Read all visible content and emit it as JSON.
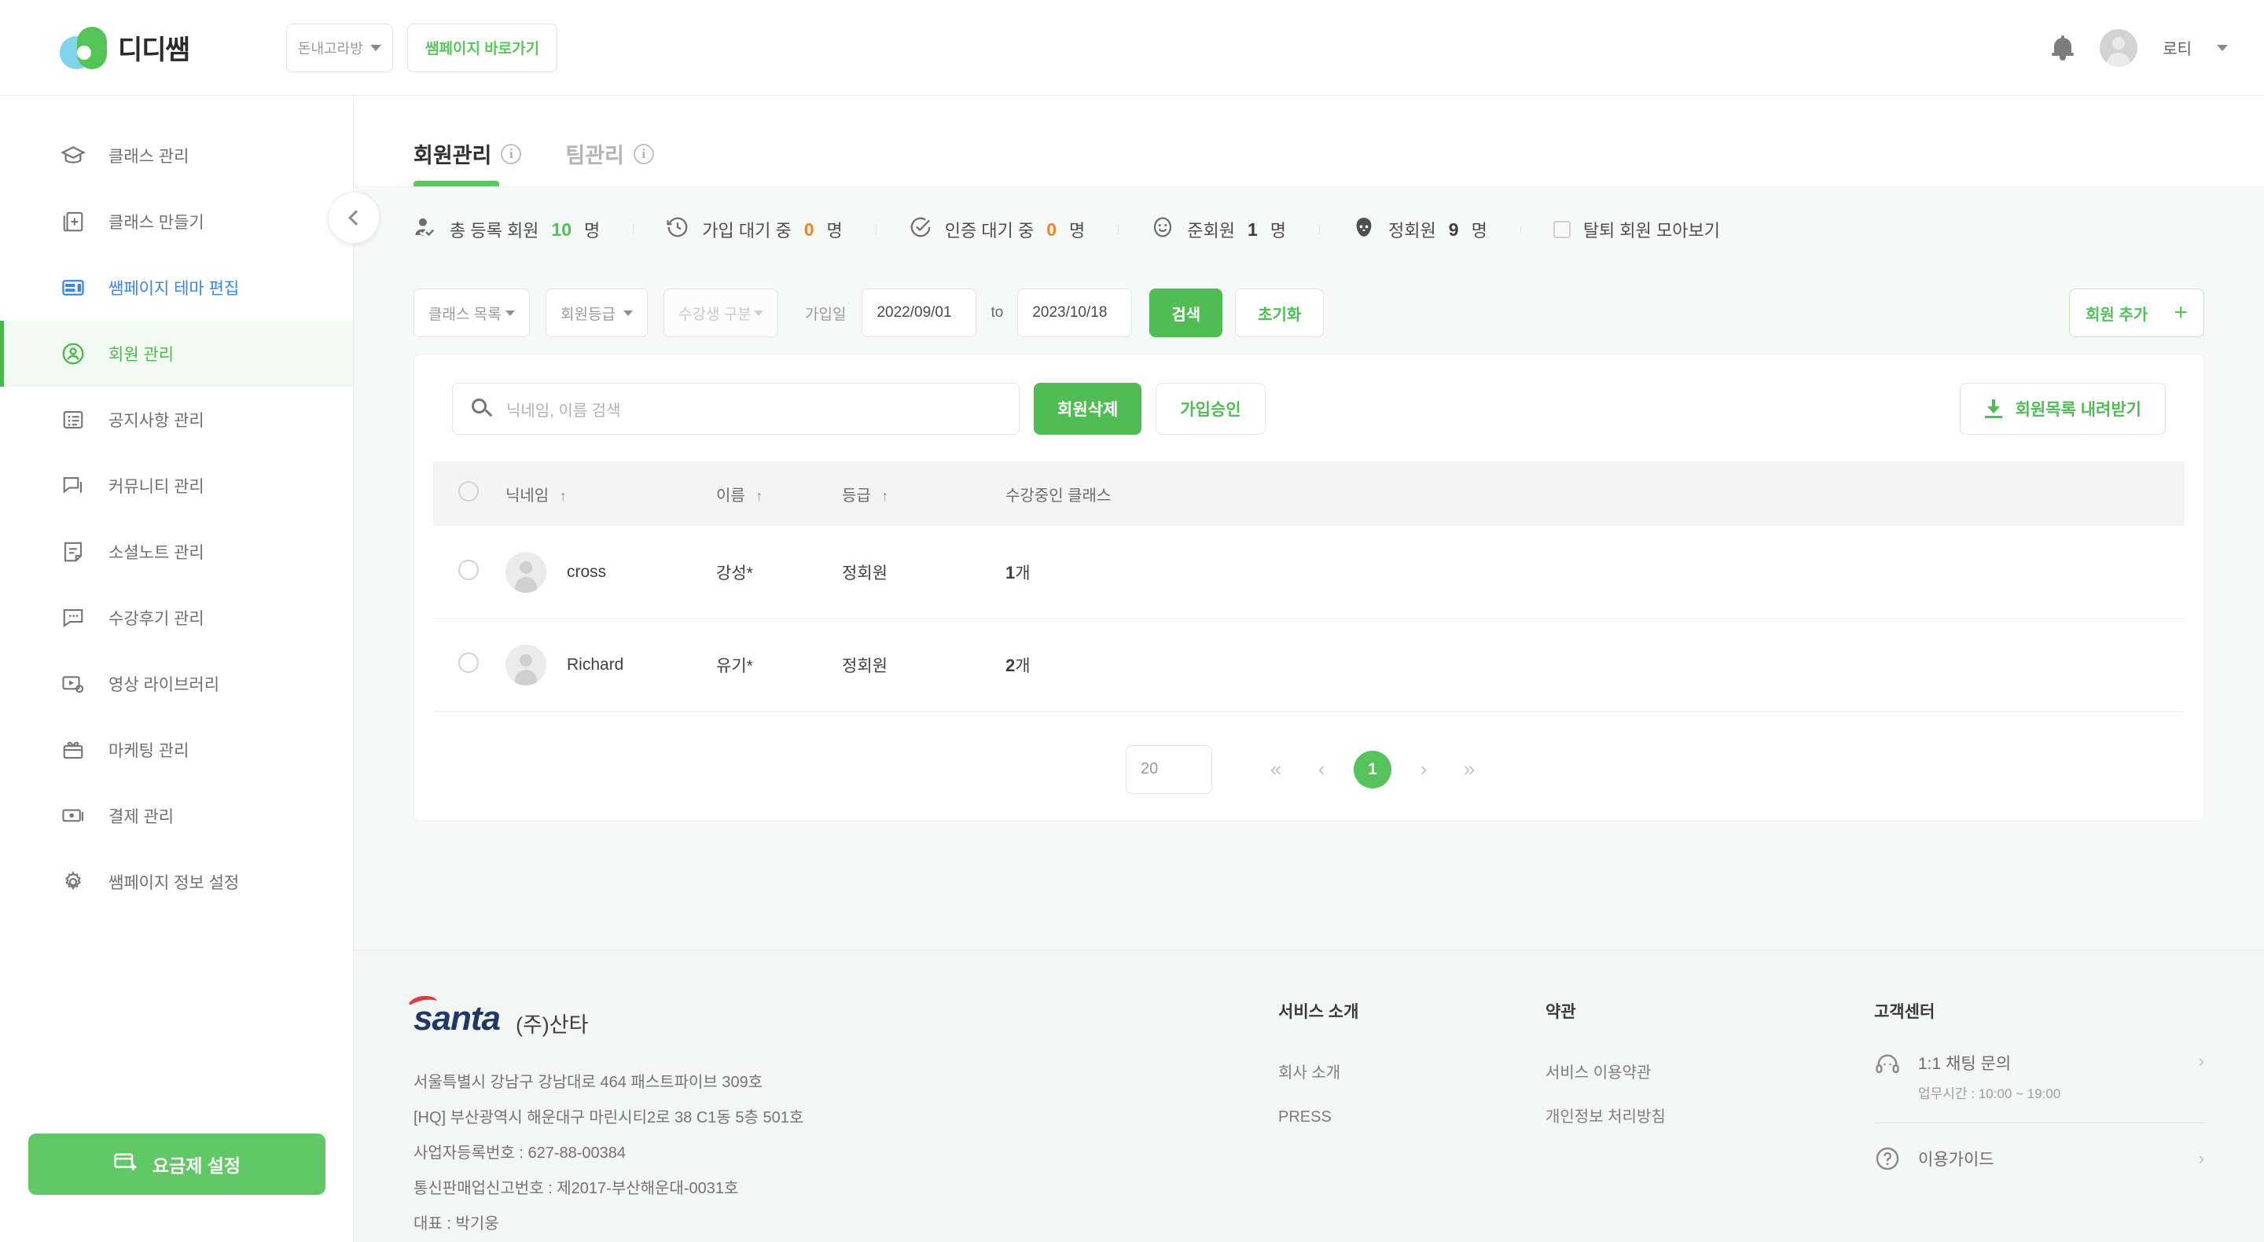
{
  "header": {
    "logo_text": "디디쌤",
    "logo_icon": "didissam-logo-icon",
    "studio_select": "돈내고라방",
    "sam_page_button": "쌤페이지 바로가기",
    "bell_icon": "bell-icon",
    "user_name": "로티",
    "avatar_icon": "avatar-icon"
  },
  "sidebar": {
    "items": [
      {
        "label": "클래스 관리",
        "icon": "graduation-cap-icon",
        "state": "default"
      },
      {
        "label": "클래스 만들기",
        "icon": "add-page-icon",
        "state": "default"
      },
      {
        "label": "쌤페이지 테마 편집",
        "icon": "layout-edit-icon",
        "state": "highlight"
      },
      {
        "label": "회원 관리",
        "icon": "user-circle-icon",
        "state": "active"
      },
      {
        "label": "공지사항 관리",
        "icon": "list-board-icon",
        "state": "default"
      },
      {
        "label": "커뮤니티 관리",
        "icon": "chat-bubbles-icon",
        "state": "default"
      },
      {
        "label": "소셜노트 관리",
        "icon": "note-icon",
        "state": "default"
      },
      {
        "label": "수강후기 관리",
        "icon": "comment-dots-icon",
        "state": "default"
      },
      {
        "label": "영상 라이브러리",
        "icon": "video-settings-icon",
        "state": "default"
      },
      {
        "label": "마케팅 관리",
        "icon": "gift-icon",
        "state": "default"
      },
      {
        "label": "결제 관리",
        "icon": "money-icon",
        "state": "default"
      },
      {
        "label": "쌤페이지 정보 설정",
        "icon": "gear-icon",
        "state": "default"
      }
    ],
    "plan_button": {
      "label": "요금제 설정",
      "icon": "card-plus-icon"
    },
    "collapse_icon": "chevron-left-icon"
  },
  "tabs": [
    {
      "label": "회원관리",
      "info_icon": "info-icon",
      "active": true
    },
    {
      "label": "팀관리",
      "info_icon": "info-icon",
      "active": false
    }
  ],
  "stats": [
    {
      "icon": "user-check-icon",
      "label": "총 등록 회원",
      "value": "10",
      "unit": "명",
      "value_color": "#4cc251"
    },
    {
      "icon": "clock-history-icon",
      "label": "가입 대기 중",
      "value": "0",
      "unit": "명",
      "value_color": "#ef8524"
    },
    {
      "icon": "check-circle-icon",
      "label": "인증 대기 중",
      "value": "0",
      "unit": "명",
      "value_color": "#ef8524"
    },
    {
      "icon": "smile-face-icon",
      "label": "준회원",
      "value": "1",
      "unit": "명",
      "value_color": "#3d3d3d"
    },
    {
      "icon": "person-face-icon",
      "label": "정회원",
      "value": "9",
      "unit": "명",
      "value_color": "#3d3d3d"
    }
  ],
  "withdraw_filter": {
    "label": "탈퇴 회원 모아보기",
    "checkbox_icon": "checkbox-unchecked-icon",
    "checked": false
  },
  "filters": {
    "class_select": "클래스 목록",
    "grade_select": "회원등급",
    "student_select": "수강생 구분",
    "date_label": "가입일",
    "date_from": "2022/09/01",
    "date_to_text": "to",
    "date_to": "2023/10/18",
    "search_button": "검색",
    "reset_button": "초기화",
    "add_member_button": "회원 추가",
    "add_member_icon": "plus-icon"
  },
  "toolbar": {
    "search_placeholder": "닉네임, 이름 검색",
    "search_value": "",
    "search_icon": "search-icon",
    "delete_button": "회원삭제",
    "approve_button": "가입승인",
    "download_button": "회원목록 내려받기",
    "download_icon": "download-icon"
  },
  "table": {
    "columns": [
      {
        "label": "닉네임",
        "sort": "↑"
      },
      {
        "label": "이름",
        "sort": "↑"
      },
      {
        "label": "등급",
        "sort": "↑"
      },
      {
        "label": "수강중인 클래스",
        "sort": ""
      }
    ],
    "rows": [
      {
        "nickname": "cross",
        "name": "강성*",
        "grade": "정회원",
        "class_count": "1",
        "class_unit": "개"
      },
      {
        "nickname": "Richard",
        "name": "유기*",
        "grade": "정회원",
        "class_count": "2",
        "class_unit": "개"
      }
    ]
  },
  "pagination": {
    "page_size": "20",
    "first_icon": "«",
    "prev_icon": "‹",
    "current_page": "1",
    "next_icon": "›",
    "last_icon": "»"
  },
  "footer": {
    "brand_logo": "santa",
    "brand_name": "(주)산타",
    "address_lines": [
      "서울특별시 강남구 강남대로 464 패스트파이브 309호",
      "[HQ] 부산광역시 해운대구 마린시티2로 38 C1동 5층 501호",
      "사업자등록번호 : 627-88-00384",
      "통신판매업신고번호 : 제2017-부산해운대-0031호",
      "대표 : 박기웅"
    ],
    "columns": [
      {
        "heading": "서비스 소개",
        "links": [
          "회사 소개",
          "PRESS"
        ]
      },
      {
        "heading": "약관",
        "links": [
          "서비스 이용약관",
          "개인정보 처리방침"
        ]
      }
    ],
    "customer_center": {
      "heading": "고객센터",
      "chat": {
        "title": "1:1 채팅 문의",
        "sub": "업무시간 : 10:00 ~ 19:00",
        "icon": "headset-icon",
        "chevron": "›"
      },
      "guide": {
        "title": "이용가이드",
        "icon": "question-circle-icon",
        "chevron": "›"
      }
    }
  },
  "colors": {
    "accent_green": "#4fbd53",
    "accent_blue": "#3b85e8",
    "warning_orange": "#ef8524",
    "page_bg": "#f7f9f8"
  }
}
